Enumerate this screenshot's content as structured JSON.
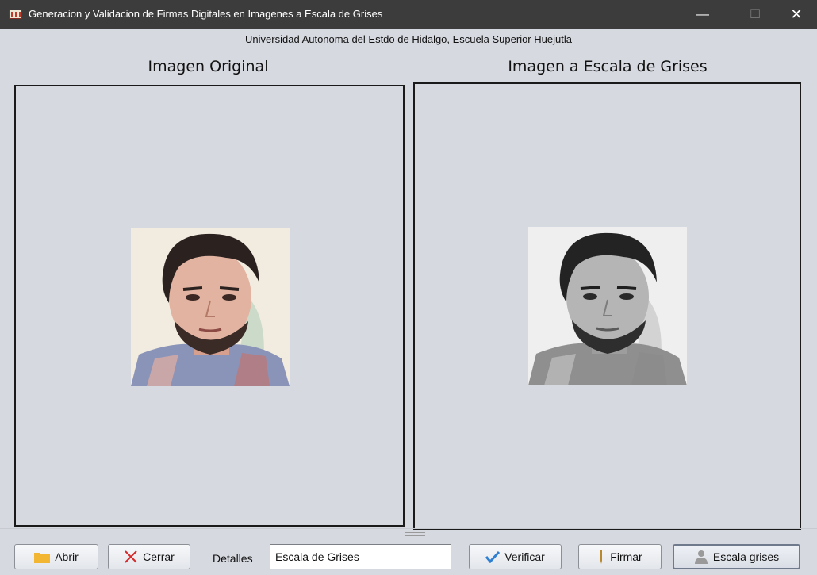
{
  "window": {
    "title": "Generacion y Validacion de Firmas Digitales en Imagenes a Escala de Grises",
    "controls": {
      "minimize": "—",
      "maximize": "☐",
      "close": "✕"
    }
  },
  "subtitle": "Universidad Autonoma del Estdo de Hidalgo, Escuela Superior Huejutla",
  "panels": {
    "original": {
      "heading": "Imagen Original"
    },
    "grayscale": {
      "heading": "Imagen a Escala de Grises"
    }
  },
  "toolbar": {
    "abrir_label": "Abrir",
    "cerrar_label": "Cerrar",
    "detalles_label": "Detalles",
    "detalles_value": "Escala de Grises",
    "verificar_label": "Verificar",
    "firmar_label": "Firmar",
    "escala_label": "Escala grises"
  },
  "icons": {
    "abrir": "folder-icon",
    "cerrar": "x-icon",
    "verificar": "checkmark-icon",
    "firmar": "pen-icon",
    "escala": "user-icon"
  },
  "colors": {
    "background": "#d6d9e0",
    "titlebar": "#3c3c3c",
    "folder": "#f2b632",
    "close_x": "#d62a2a",
    "check": "#2f7fd3"
  }
}
